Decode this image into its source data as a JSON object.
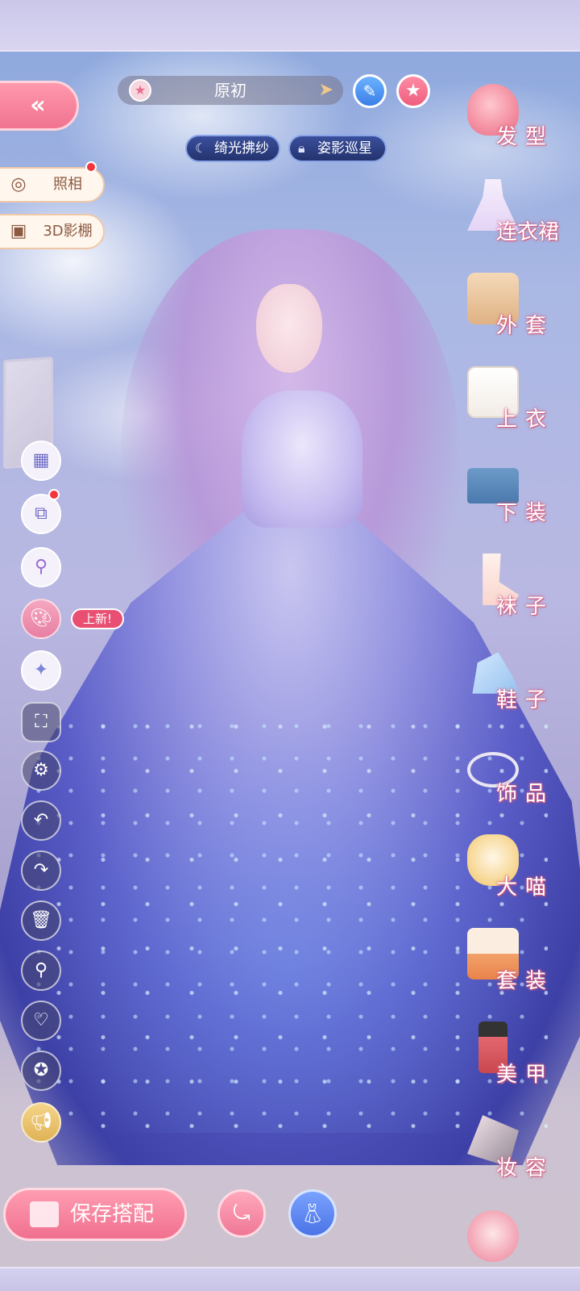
{
  "top_bar": {
    "outfit_name": "原初",
    "outfit_star_icon": "star-icon",
    "arrow_icon": "arrow-right-icon",
    "edit_icon": "pencil-icon",
    "favorite_icon": "star-icon"
  },
  "tags": [
    {
      "label": "绮光拂纱",
      "icon": "moon-icon"
    },
    {
      "label": "姿影巡星",
      "icon": "lock-icon"
    }
  ],
  "left_panel": {
    "back_glyph": "«",
    "photo_label": "照相",
    "studio_label": "3D影棚",
    "new_badge": "上新!"
  },
  "bottom": {
    "save_label": "保存搭配"
  },
  "categories": [
    {
      "label": "发型",
      "icon": "hair-icon"
    },
    {
      "label": "连衣裙",
      "icon": "dress-icon"
    },
    {
      "label": "外套",
      "icon": "coat-icon"
    },
    {
      "label": "上衣",
      "icon": "top-icon"
    },
    {
      "label": "下装",
      "icon": "bottom-icon"
    },
    {
      "label": "袜子",
      "icon": "socks-icon"
    },
    {
      "label": "鞋子",
      "icon": "shoes-icon"
    },
    {
      "label": "饰品",
      "icon": "accessory-icon"
    },
    {
      "label": "大喵",
      "icon": "pet-icon"
    },
    {
      "label": "套装",
      "icon": "suit-icon"
    },
    {
      "label": "美甲",
      "icon": "nail-polish-icon"
    },
    {
      "label": "妆容",
      "icon": "makeup-icon"
    }
  ],
  "colors": {
    "accent_pink": "#f0738f",
    "accent_blue": "#3b7fe8",
    "label_outline": "#d45c7f"
  }
}
